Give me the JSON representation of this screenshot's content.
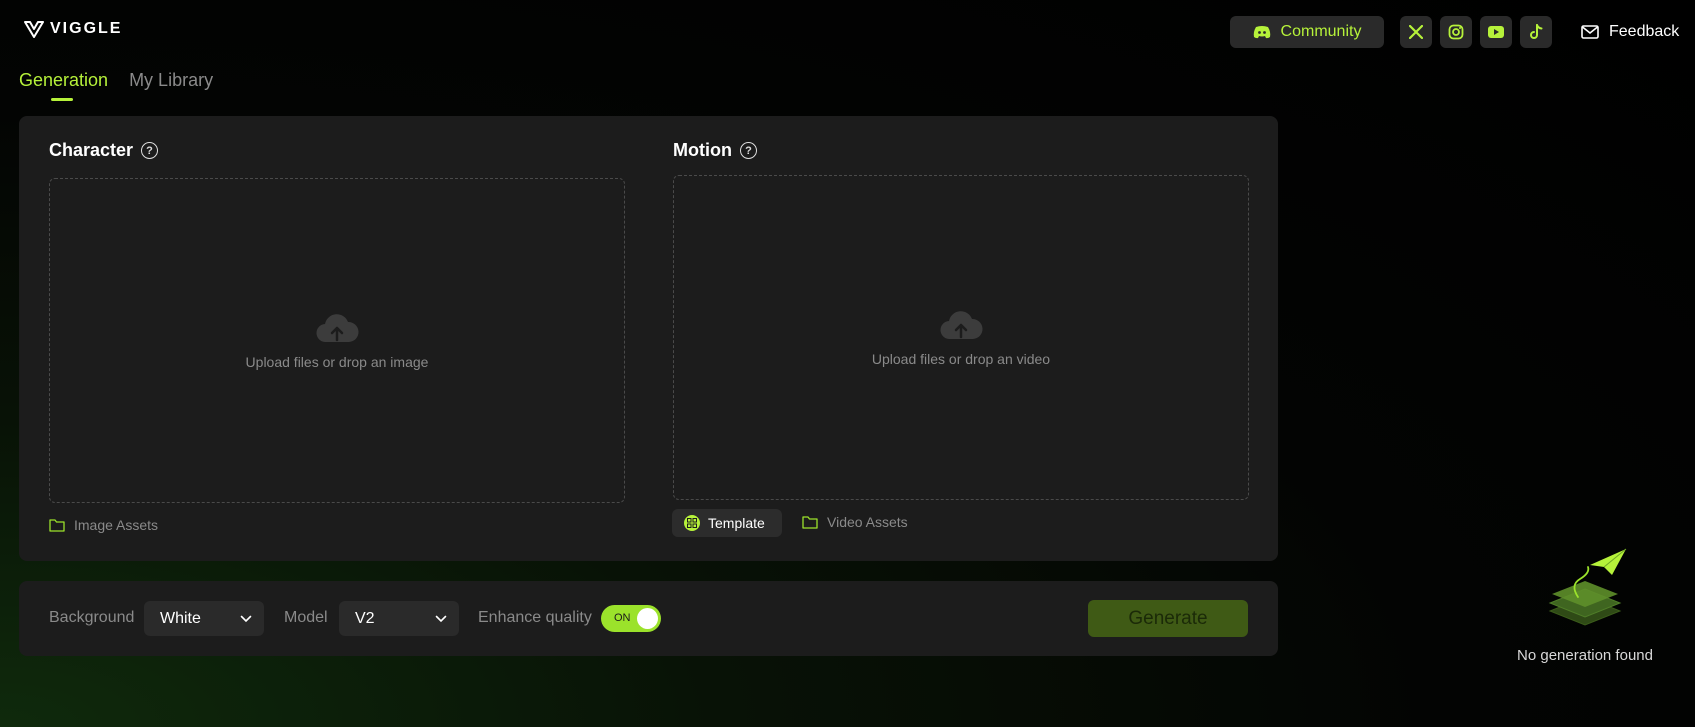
{
  "header": {
    "brand": "VIGGLE",
    "community_label": "Community",
    "social_icons": [
      "x-icon",
      "instagram-icon",
      "youtube-icon",
      "tiktok-icon"
    ],
    "feedback_label": "Feedback"
  },
  "tabs": [
    {
      "label": "Generation",
      "active": true
    },
    {
      "label": "My Library",
      "active": false
    }
  ],
  "character": {
    "title": "Character",
    "drop_text": "Upload files or drop an image",
    "assets_label": "Image Assets"
  },
  "motion": {
    "title": "Motion",
    "drop_text": "Upload files or drop an video",
    "template_label": "Template",
    "assets_label": "Video Assets"
  },
  "options": {
    "background_label": "Background",
    "background_value": "White",
    "model_label": "Model",
    "model_value": "V2",
    "enhance_label": "Enhance quality",
    "enhance_state": "ON",
    "generate_label": "Generate"
  },
  "history": {
    "empty_text": "No generation found"
  },
  "colors": {
    "accent": "#b6f23a",
    "panel": "#1c1c1c"
  }
}
